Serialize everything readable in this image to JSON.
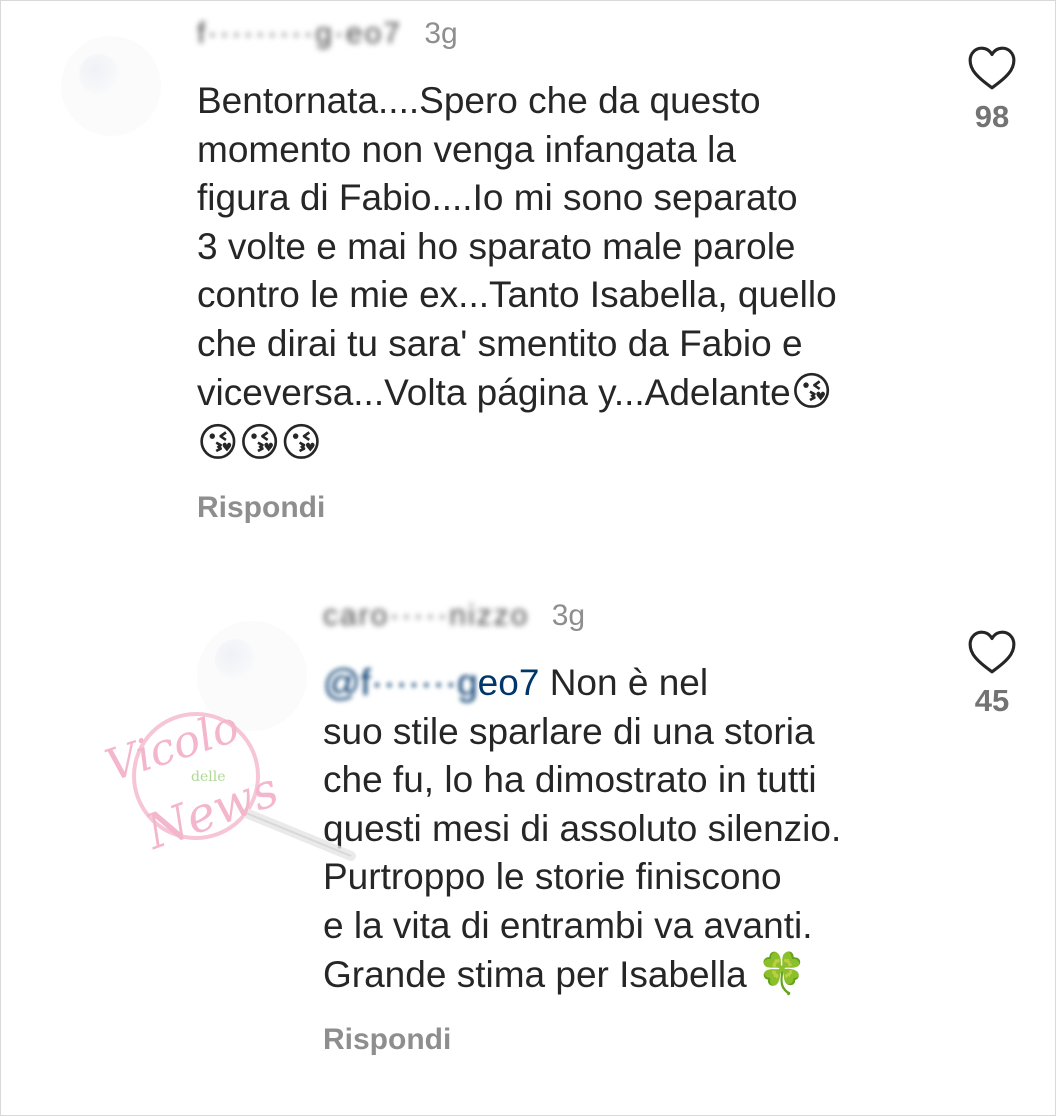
{
  "comments": [
    {
      "username": "f·········g·ео7",
      "time": "3g",
      "text": "Bentornata....Spero che da questo\nmomento non venga infangata la\nfigura di Fabio....Io mi sono separato\n3 volte e mai ho sparato male parole\ncontro le mie ex...Tanto Isabella, quello\nche dirai tu sara' smentito da Fabio e\nviceversa...Volta página y...Adelante",
      "emoji_inline": "😘",
      "emoji_line": "😘😘😘",
      "reply_label": "Rispondi",
      "likes": "98"
    },
    {
      "username": "carо·····nizzo",
      "time": "3g",
      "mention": "@f·······g",
      "mention_tail": "ео7",
      "text": "Non è nel\nsuo stile sparlare di una storia\nche fu, lo ha dimostrato in tutti\nquesti mesi di assoluto silenzio.\nPurtroppo le storie finiscono\ne la vita di entrambi va avanti.\nGrande stima per Isabella",
      "emoji_trailing": "🍀",
      "reply_label": "Rispondi",
      "likes": "45"
    }
  ],
  "watermark": {
    "line1": "Vicolo",
    "line2": "delle",
    "line3": "News"
  },
  "colors": {
    "text": "#262626",
    "secondary": "#8e8e8e",
    "mention": "#00376b",
    "watermark": "#f2a5c0"
  },
  "icons": {
    "like": "heart-outline-icon"
  }
}
